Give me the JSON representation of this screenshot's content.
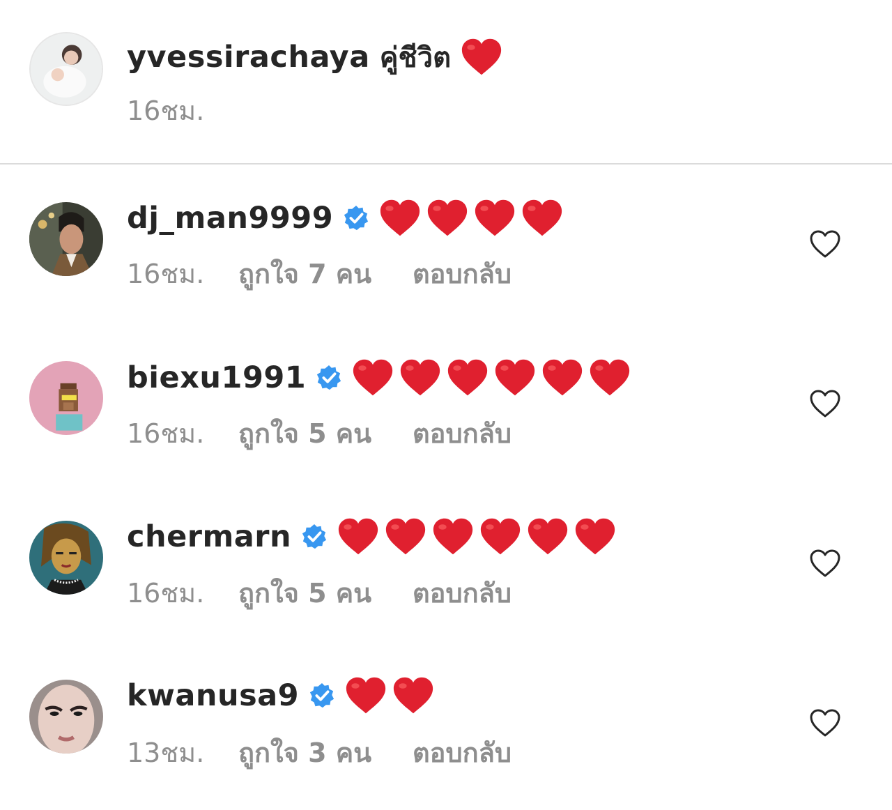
{
  "caption": {
    "username": "yvessirachaya",
    "text": "คู่ชีวิต",
    "hearts": 1,
    "time": "16ชม."
  },
  "comments": [
    {
      "username": "dj_man9999",
      "verified": true,
      "hearts": 4,
      "time": "16ชม.",
      "likes": "ถูกใจ 7 คน",
      "reply": "ตอบกลับ"
    },
    {
      "username": "biexu1991",
      "verified": true,
      "hearts": 6,
      "time": "16ชม.",
      "likes": "ถูกใจ 5 คน",
      "reply": "ตอบกลับ"
    },
    {
      "username": "chermarn",
      "verified": true,
      "hearts": 6,
      "time": "16ชม.",
      "likes": "ถูกใจ 5 คน",
      "reply": "ตอบกลับ"
    },
    {
      "username": "kwanusa9",
      "verified": true,
      "hearts": 2,
      "time": "13ชม.",
      "likes": "ถูกใจ 3 คน",
      "reply": "ตอบกลับ"
    }
  ],
  "icons": {
    "heart_emoji": "red-heart-emoji",
    "verified": "verified-badge-icon",
    "like": "heart-outline-icon"
  },
  "colors": {
    "heart": "#e0202f",
    "verified": "#3897f0",
    "secondary_text": "#8e8e8e",
    "divider": "#dbdbdb"
  }
}
